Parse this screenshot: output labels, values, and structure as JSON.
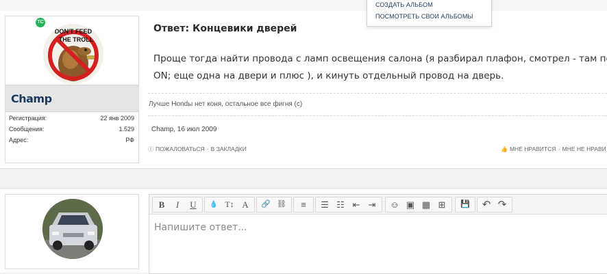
{
  "dropdown": {
    "items": [
      "СОЗДАТЬ АЛЬБОМ",
      "ПОСМОТРЕТЬ СВОИ АЛЬБОМЫ"
    ]
  },
  "post": {
    "badge": "TC",
    "username": "Champ",
    "avatar_text": [
      "DON'T FEED",
      "THE TROLL"
    ],
    "stats": [
      {
        "label": "Регистрация:",
        "value": "22 янв 2009"
      },
      {
        "label": "Сообщения:",
        "value": "1.529"
      },
      {
        "label": "Адрес:",
        "value": "РФ"
      }
    ],
    "title": "Ответ: Концевики дверей",
    "body_line1": "Проще тогда найти провода с ламп освещения салона (я разбирал плафон, смотрел - там пост",
    "body_line2": "ON; еще одна на двери и плюс ), и кинуть отдельный провод на дверь.",
    "signature": "Лучше Hondы нет коня, остальное все фигня (c)",
    "date": "Champ, 16 июл 2009",
    "actions": {
      "report": "Пожаловаться",
      "bookmark": "В закладки",
      "like": "Мне нравится",
      "dislike": "Мне не нрави"
    }
  },
  "reply": {
    "placeholder": "Напишите ответ...",
    "toolbar": {
      "bold": "B",
      "italic": "I",
      "underline": "U",
      "color": "💧",
      "fontsize": "T↕",
      "font": "A",
      "link": "🔗",
      "unlink": "⛓",
      "align": "≡",
      "ul": "☰",
      "ol": "☷",
      "outdent": "⇤",
      "indent": "⇥",
      "smiley": "☺",
      "image": "▣",
      "media": "▦",
      "insert": "⊞",
      "save": "💾",
      "undo": "↶",
      "redo": "↷"
    }
  }
}
